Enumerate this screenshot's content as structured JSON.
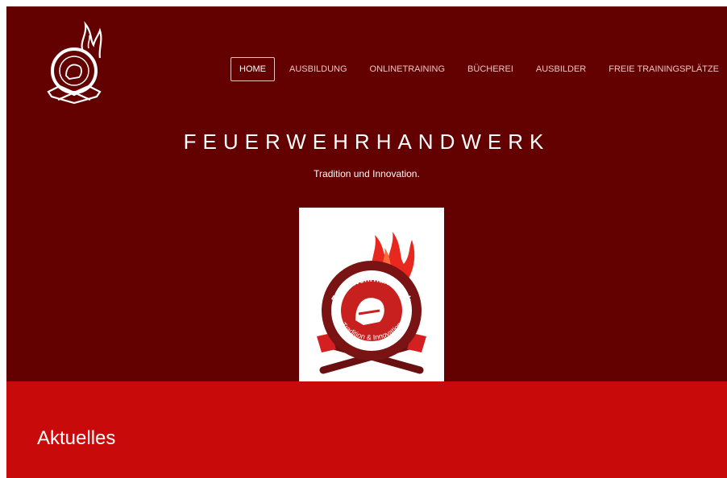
{
  "nav": {
    "items": [
      {
        "label": "HOME",
        "active": true
      },
      {
        "label": "AUSBILDUNG",
        "active": false
      },
      {
        "label": "ONLINETRAINING",
        "active": false
      },
      {
        "label": "BÜCHEREI",
        "active": false
      },
      {
        "label": "AUSBILDER",
        "active": false
      },
      {
        "label": "FREIE TRAININGSPLÄTZE",
        "active": false
      }
    ]
  },
  "hero": {
    "title": "FEUERWEHRHANDWERK",
    "tagline": "Tradition und Innovation."
  },
  "badge": {
    "top_text": "Feuerwehrhandwerk",
    "bottom_text": "Tradition & Innovation"
  },
  "news": {
    "title": "Aktuelles"
  },
  "colors": {
    "hero_bg": "#630000",
    "news_bg": "#c80a0a",
    "brand_red": "#c8201e",
    "nav_text": "#ecc3c3"
  },
  "icons": {
    "header_logo": "fire-helmet-emblem-icon",
    "badge_logo": "feuerwehrhandwerk-badge-icon"
  }
}
